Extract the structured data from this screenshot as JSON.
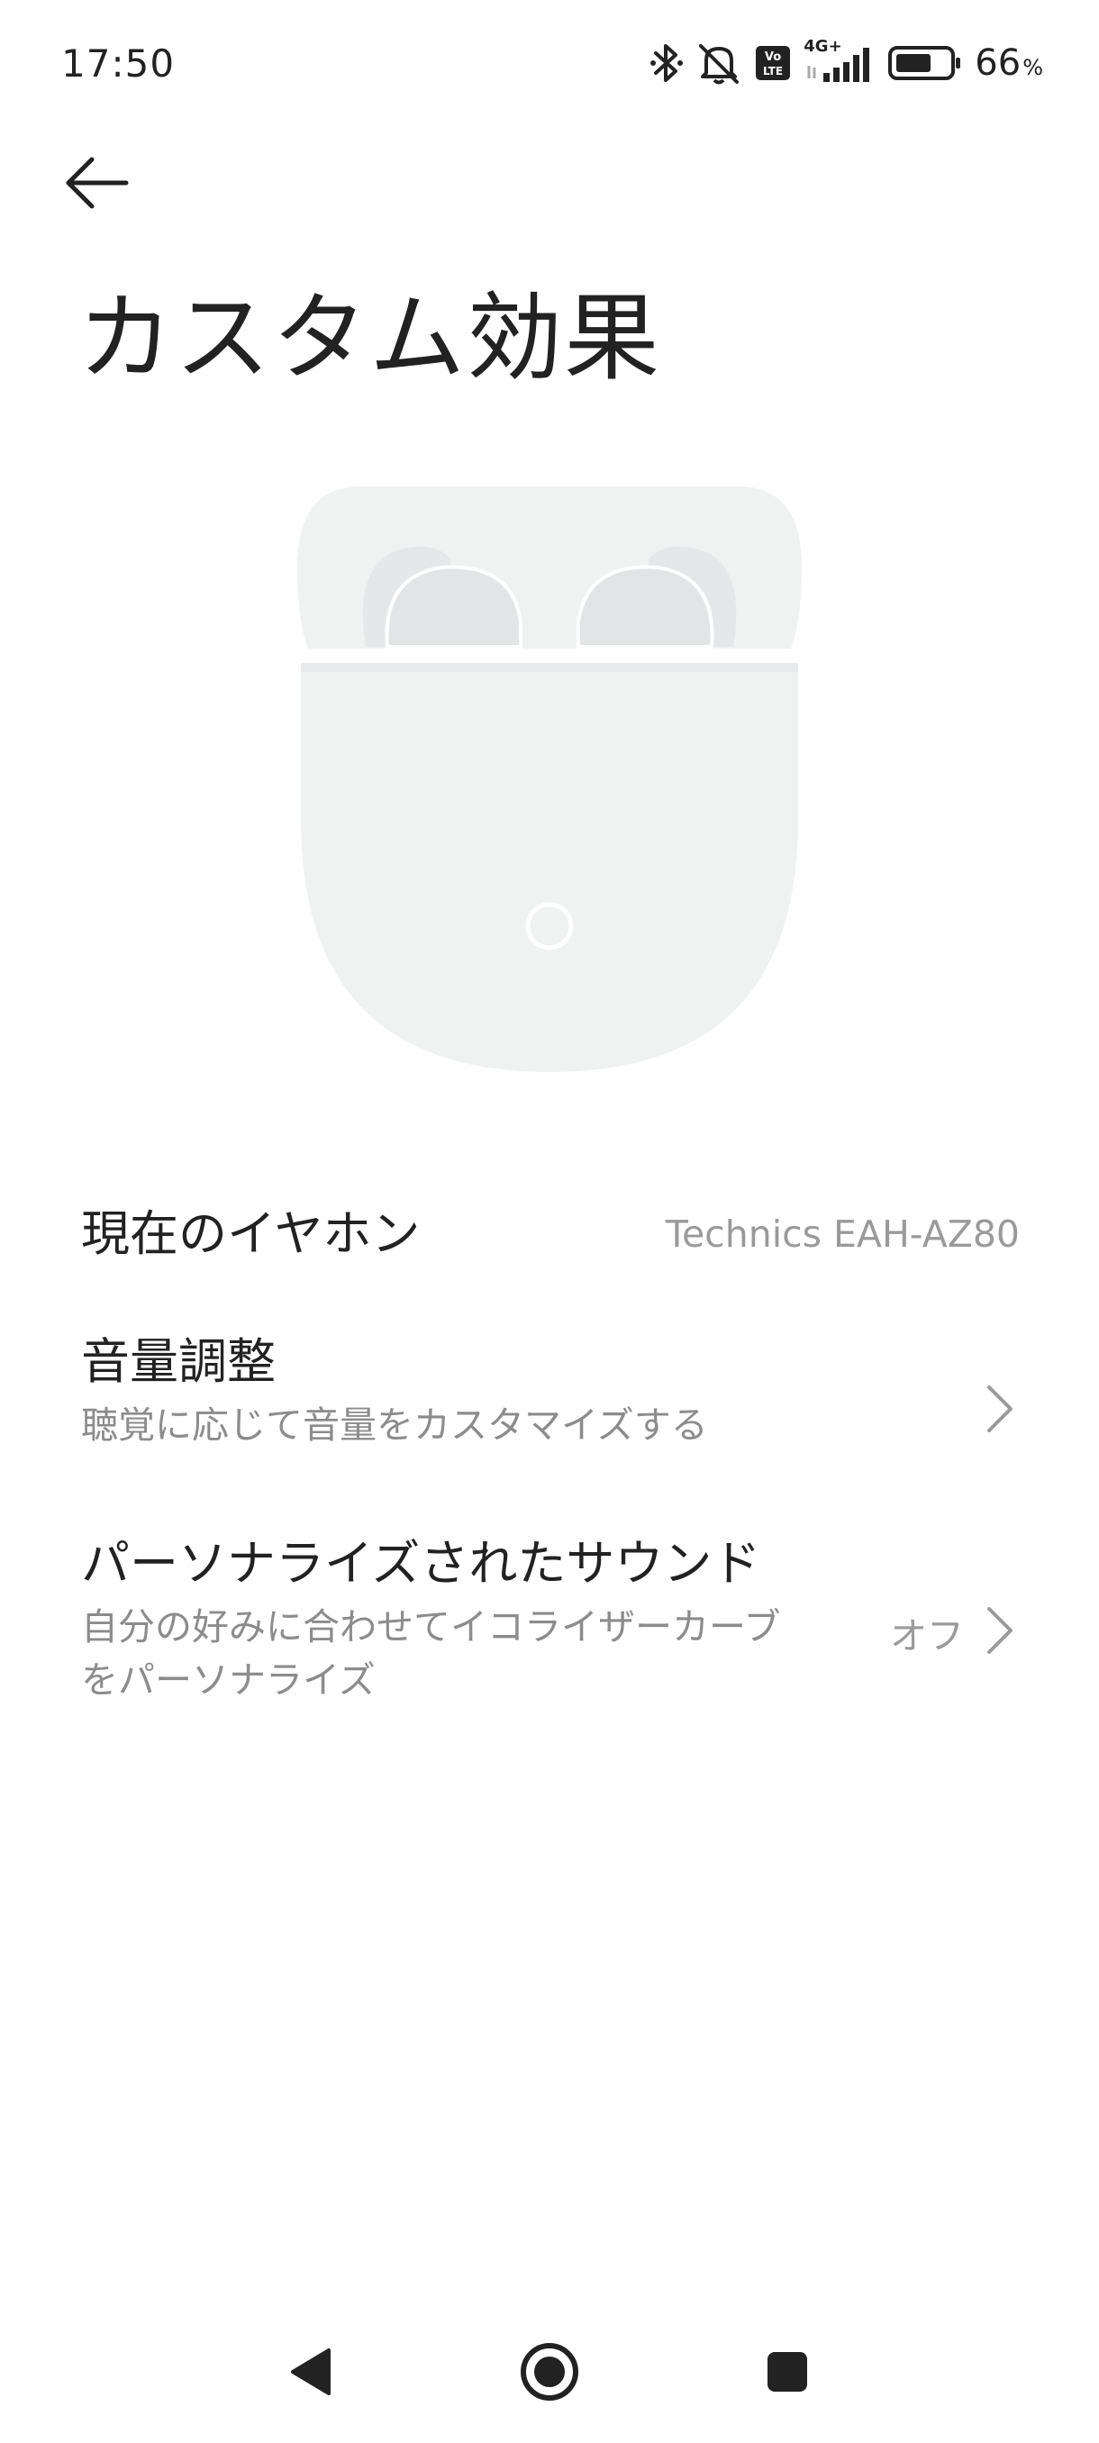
{
  "status_bar": {
    "time": "17:50",
    "network": "4G+",
    "volte": "Vo LTE",
    "battery_percent": "66",
    "battery_unit": "%",
    "battery_level": 0.66,
    "icons": [
      "bluetooth-icon",
      "muted-bell-icon",
      "volte-icon",
      "signal-icon",
      "battery-icon"
    ]
  },
  "header": {
    "back_icon": "arrow-left-icon",
    "title": "カスタム効果"
  },
  "illustration": {
    "name": "earbuds-case-illustration",
    "color": "#f0f1f1",
    "earbud_color": "#e3e4e5"
  },
  "settings": {
    "current_earphone": {
      "label": "現在のイヤホン",
      "value": "Technics EAH-AZ80"
    },
    "volume_adjust": {
      "title": "音量調整",
      "subtitle": "聴覚に応じて音量をカスタマイズする",
      "icon": "chevron-right-icon"
    },
    "personalized_sound": {
      "title": "パーソナライズされたサウンド",
      "subtitle_line1": "自分の好みに合わせてイコライザーカーブ",
      "subtitle_line2": "をパーソナライズ",
      "status": "オフ",
      "icon": "chevron-right-icon"
    }
  },
  "nav_bar": {
    "back_icon": "triangle-back-icon",
    "home_icon": "circle-home-icon",
    "recents_icon": "square-recents-icon"
  },
  "colors": {
    "text_primary": "#222222",
    "text_secondary": "#8c8c8c",
    "background": "#ffffff",
    "chevron": "#9a9a9a"
  }
}
